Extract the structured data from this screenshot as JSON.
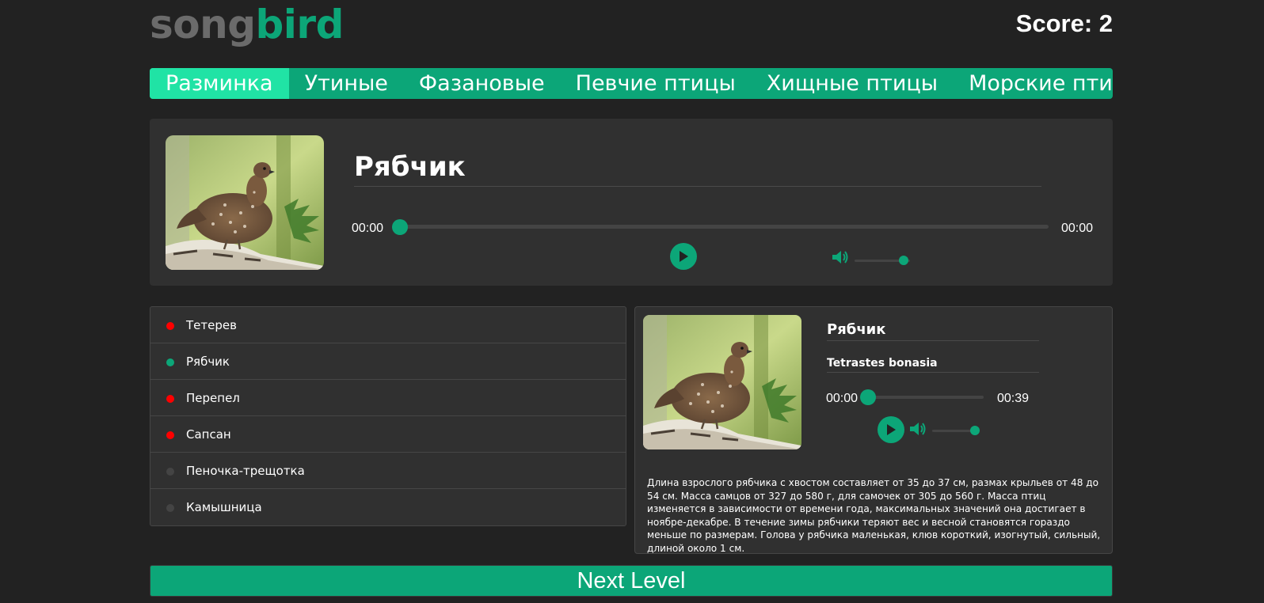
{
  "header": {
    "logo_part1": "song",
    "logo_part2": "bird",
    "score": "Score: 2"
  },
  "nav": [
    {
      "label": "Разминка",
      "active": true
    },
    {
      "label": "Утиные",
      "active": false
    },
    {
      "label": "Фазановые",
      "active": false
    },
    {
      "label": "Певчие птицы",
      "active": false
    },
    {
      "label": "Хищные птицы",
      "active": false
    },
    {
      "label": "Морские птицы",
      "active": false
    }
  ],
  "question": {
    "bird_name": "Рябчик",
    "image_icon": "bird-photo",
    "player": {
      "current_time": "00:00",
      "duration": "00:00",
      "progress": 0,
      "volume": 1
    }
  },
  "answers": [
    {
      "label": "Тетерев",
      "status": "wrong"
    },
    {
      "label": "Рябчик",
      "status": "correct"
    },
    {
      "label": "Перепел",
      "status": "wrong"
    },
    {
      "label": "Сапсан",
      "status": "wrong"
    },
    {
      "label": "Пеночка-трещотка",
      "status": "none"
    },
    {
      "label": "Камышница",
      "status": "none"
    }
  ],
  "details": {
    "name": "Рябчик",
    "latin": "Tetrastes bonasia",
    "player": {
      "current_time": "00:00",
      "duration": "00:39",
      "progress": 0,
      "volume": 1
    },
    "description": "Длина взрослого рябчика с хвостом составляет от 35 до 37 см, размах крыльев от 48 до 54 см. Масса самцов от 327 до 580 г, для самочек от 305 до 560 г. Масса птиц изменяется в зависимости от времени года, максимальных значений она достигает в ноябре-декабре. В течение зимы рябчики теряют вес и весной становятся гораздо меньше по размерам. Голова у рябчика маленькая, клюв короткий, изогнутый, сильный, длиной около 1 см."
  },
  "next_button": "Next Level",
  "colors": {
    "accent": "#0ca678",
    "accent_active": "#20e3a5",
    "correct": "#0ca678",
    "wrong": "#ff0000",
    "none": "#444444",
    "background": "#222222",
    "panel": "#303030"
  }
}
